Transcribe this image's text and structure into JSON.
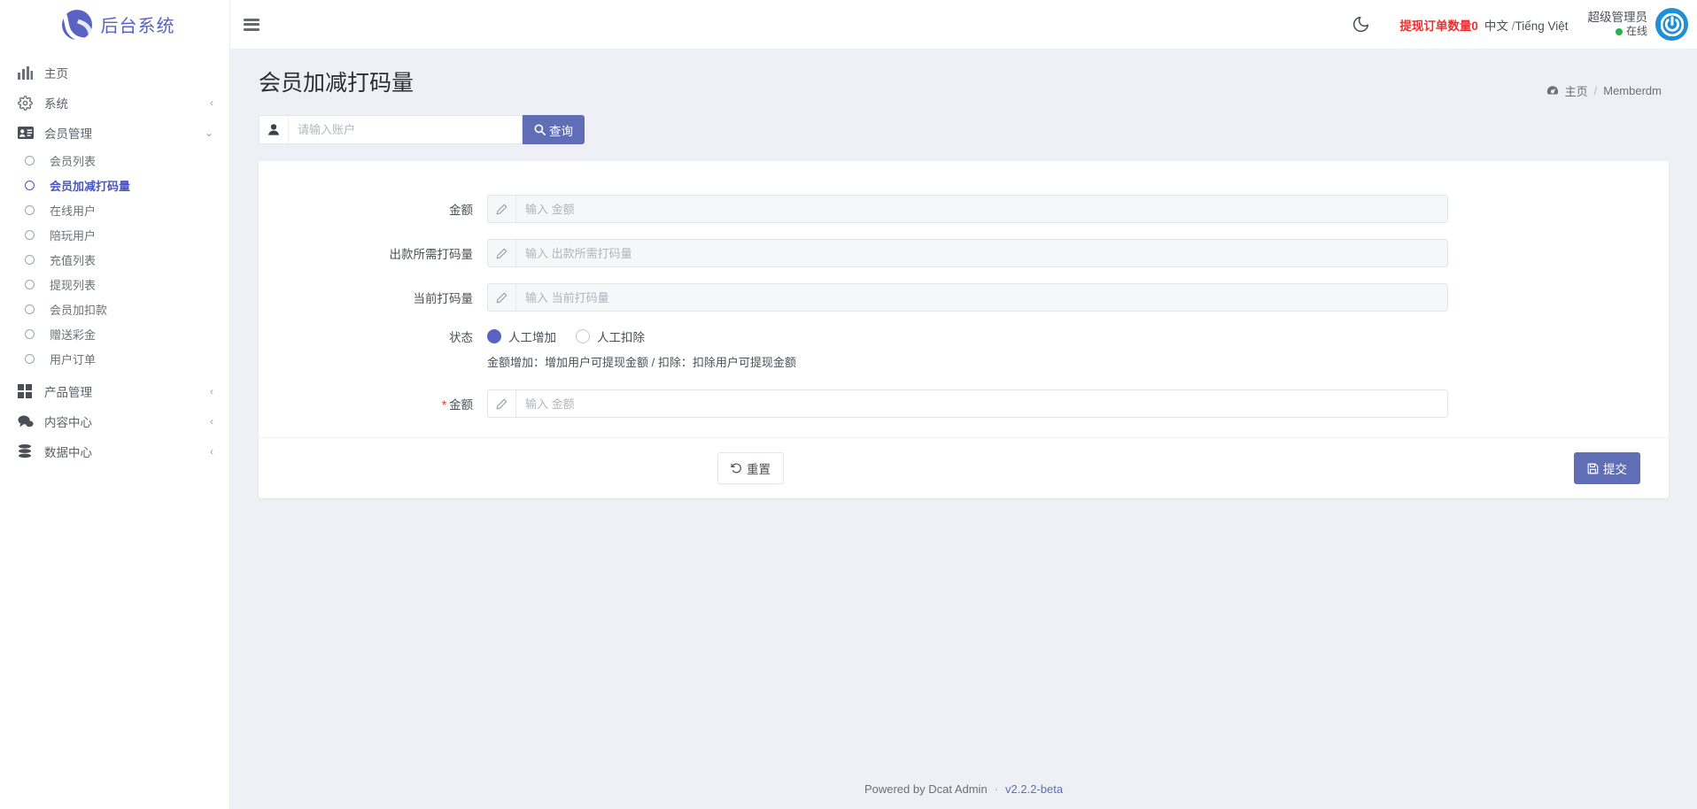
{
  "brand": {
    "title": "后台系统",
    "logo_icon": "swoosh-circle-logo"
  },
  "sidebar": {
    "items": [
      {
        "label": "主页",
        "icon": "chart-bars-icon",
        "caret": "",
        "type": "top"
      },
      {
        "label": "系统",
        "icon": "gear-icon",
        "caret": "‹",
        "type": "top"
      },
      {
        "label": "会员管理",
        "icon": "id-card-icon",
        "caret": "⌄",
        "type": "top",
        "expanded": true
      }
    ],
    "member_children": [
      {
        "label": "会员列表",
        "active": false
      },
      {
        "label": "会员加减打码量",
        "active": true
      },
      {
        "label": "在线用户",
        "active": false
      },
      {
        "label": "陪玩用户",
        "active": false
      },
      {
        "label": "充值列表",
        "active": false
      },
      {
        "label": "提现列表",
        "active": false
      },
      {
        "label": "会员加扣款",
        "active": false
      },
      {
        "label": "赠送彩金",
        "active": false
      },
      {
        "label": "用户订单",
        "active": false
      }
    ],
    "items_bottom": [
      {
        "label": "产品管理",
        "icon": "grid-squares-icon",
        "caret": "‹"
      },
      {
        "label": "内容中心",
        "icon": "chat-bubbles-icon",
        "caret": "‹"
      },
      {
        "label": "数据中心",
        "icon": "database-icon",
        "caret": "‹"
      }
    ]
  },
  "header": {
    "menu_toggle_icon": "hamburger-icon",
    "dark_mode_icon": "moon-icon",
    "order_count_label": "提现订单数量0",
    "language": "中文 /Tiếng Việt",
    "lang_primary": "中文",
    "lang_sep": "/",
    "lang_secondary": "Tiếng Việt",
    "user_name": "超级管理员",
    "user_status": "在线",
    "avatar_icon": "power-icon",
    "order_count_color": "#f22c2c",
    "status_color": "#22b24c"
  },
  "page": {
    "title": "会员加减打码量",
    "breadcrumb": {
      "home_icon": "dashboard-icon",
      "home": "主页",
      "separator": "/",
      "current": "Memberdm"
    }
  },
  "search": {
    "prefix_icon": "user-icon",
    "placeholder": "请输入账户",
    "value": "",
    "button_label": "查询",
    "button_icon": "search-icon"
  },
  "form": {
    "fields": [
      {
        "label": "金额",
        "placeholder": "输入 金额",
        "value": "",
        "required": false,
        "readonly": true,
        "prefix_icon": "pencil-icon"
      },
      {
        "label": "出款所需打码量",
        "placeholder": "输入 出款所需打码量",
        "value": "",
        "required": false,
        "readonly": true,
        "prefix_icon": "pencil-icon"
      },
      {
        "label": "当前打码量",
        "placeholder": "输入 当前打码量",
        "value": "",
        "required": false,
        "readonly": true,
        "prefix_icon": "pencil-icon"
      }
    ],
    "radio": {
      "label": "状态",
      "options": [
        {
          "label": "人工增加",
          "checked": true
        },
        {
          "label": "人工扣除",
          "checked": false
        }
      ]
    },
    "helper_text": "金额增加：增加用户可提现金额 / 扣除：扣除用户可提现金额",
    "amount_field": {
      "label": "金额",
      "placeholder": "输入 金额",
      "value": "",
      "required": true,
      "readonly": false,
      "prefix_icon": "pencil-icon"
    },
    "reset_label": "重置",
    "reset_icon": "undo-icon",
    "submit_label": "提交",
    "submit_icon": "save-icon"
  },
  "footer": {
    "powered": "Powered by Dcat Admin",
    "dot": "·",
    "version": "v2.2.2-beta"
  },
  "colors": {
    "accent": "#5f6eb5",
    "brand": "#5a63c4",
    "danger": "#f22c2c",
    "online": "#22b24c"
  }
}
